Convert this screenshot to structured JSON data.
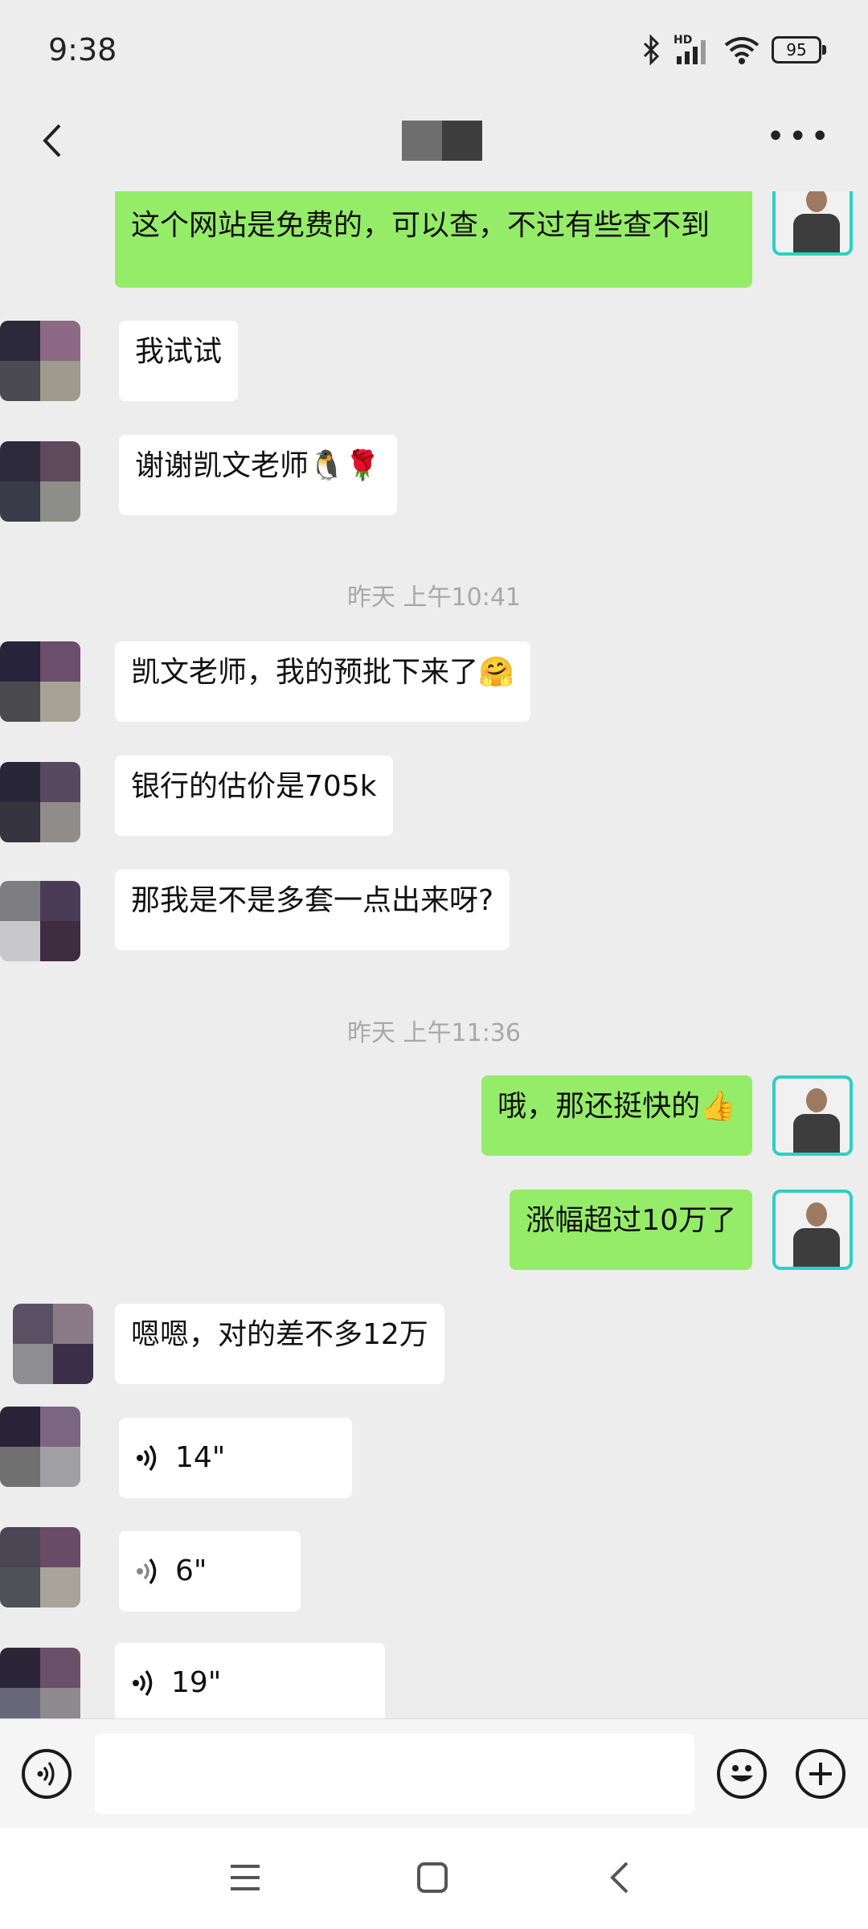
{
  "status_bar": {
    "time": "9:38",
    "battery": "95",
    "network_label": "HD"
  },
  "nav": {
    "title": ""
  },
  "messages": [
    {
      "side": "out",
      "text": "这个网站是免费的，可以查，不过有些查不到"
    },
    {
      "side": "in",
      "text": "我试试"
    },
    {
      "side": "in",
      "text": "谢谢凯文老师🐧🌹"
    },
    {
      "type": "time",
      "text": "昨天 上午10:41"
    },
    {
      "side": "in",
      "text": "凯文老师，我的预批下来了🤗"
    },
    {
      "side": "in",
      "text": "银行的估价是705k"
    },
    {
      "side": "in",
      "text": "那我是不是多套一点出来呀?"
    },
    {
      "type": "time",
      "text": "昨天 上午11:36"
    },
    {
      "side": "out",
      "text": "哦，那还挺快的👍"
    },
    {
      "side": "out",
      "text": "涨幅超过10万了"
    },
    {
      "side": "in",
      "text": "嗯嗯，对的差不多12万"
    },
    {
      "side": "in",
      "voice": "14\""
    },
    {
      "side": "in",
      "voice": "6\""
    },
    {
      "side": "in",
      "voice": "19\""
    }
  ],
  "input_bar": {
    "placeholder": ""
  },
  "colors": {
    "outgoing_bubble": "#95ec69",
    "incoming_bubble": "#ffffff",
    "background": "#ededed"
  },
  "icons": {
    "back": "chevron-left-icon",
    "more": "more-icon",
    "voice_toggle": "voice-icon",
    "emoji": "emoji-icon",
    "add": "plus-icon",
    "sys_menu": "menu-icon",
    "sys_home": "home-icon",
    "sys_back": "back-icon"
  }
}
